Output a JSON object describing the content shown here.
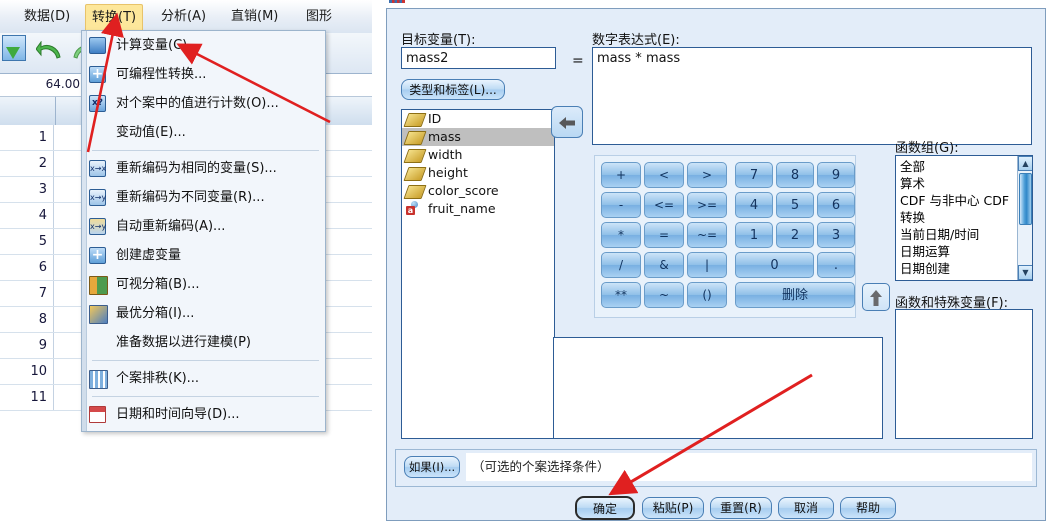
{
  "app": {
    "menubar": [
      {
        "label": "数据(D)",
        "accel": "D",
        "active": false
      },
      {
        "label": "转换(T)",
        "accel": "T",
        "active": true
      },
      {
        "label": "分析(A)",
        "accel": "A",
        "active": false
      },
      {
        "label": "直销(M)",
        "accel": "M",
        "active": false
      },
      {
        "label": "图形",
        "accel": "",
        "active": false
      }
    ],
    "cell_value": "64.00",
    "row_numbers": [
      "1",
      "2",
      "3",
      "4",
      "5",
      "6",
      "7",
      "8",
      "9",
      "10",
      "11"
    ]
  },
  "transform_menu": {
    "items": [
      {
        "label": "计算变量(C)...",
        "icon": "compute-variable-icon",
        "sep_after": false
      },
      {
        "label": "可编程性转换...",
        "icon": "programmability-transform-icon",
        "sep_after": false
      },
      {
        "label": "对个案中的值进行计数(O)...",
        "icon": "count-values-icon",
        "sep_after": false
      },
      {
        "label": "变动值(E)...",
        "icon": "none",
        "sep_after": true
      },
      {
        "label": "重新编码为相同的变量(S)...",
        "icon": "recode-same-icon",
        "sep_after": false
      },
      {
        "label": "重新编码为不同变量(R)...",
        "icon": "recode-different-icon",
        "sep_after": false
      },
      {
        "label": "自动重新编码(A)...",
        "icon": "auto-recode-icon",
        "sep_after": false
      },
      {
        "label": "创建虚变量",
        "icon": "create-dummy-icon",
        "sep_after": false
      },
      {
        "label": "可视分箱(B)...",
        "icon": "visual-binning-icon",
        "sep_after": false
      },
      {
        "label": "最优分箱(I)...",
        "icon": "optimal-binning-icon",
        "sep_after": false
      },
      {
        "label": "准备数据以进行建模(P)",
        "icon": "none",
        "sep_after": true
      },
      {
        "label": "个案排秩(K)...",
        "icon": "rank-cases-icon",
        "sep_after": true
      },
      {
        "label": "日期和时间向导(D)...",
        "icon": "date-time-wizard-icon",
        "sep_after": false
      }
    ]
  },
  "dialog": {
    "target_variable_label": "目标变量(T):",
    "target_variable_value": "mass2",
    "equals_sign": "=",
    "type_label_button": "类型和标签(L)...",
    "expression_label": "数字表达式(E):",
    "expression_value": "mass * mass",
    "move_button_icon": "arrow-left-icon",
    "up_button_icon": "arrow-up-icon",
    "variables": [
      {
        "name": "ID",
        "type": "scale",
        "selected": false
      },
      {
        "name": "mass",
        "type": "scale",
        "selected": true
      },
      {
        "name": "width",
        "type": "scale",
        "selected": false
      },
      {
        "name": "height",
        "type": "scale",
        "selected": false
      },
      {
        "name": "color_score",
        "type": "scale",
        "selected": false
      },
      {
        "name": "fruit_name",
        "type": "nominal-string",
        "selected": false
      }
    ],
    "keypad": [
      [
        "+",
        "<",
        ">",
        "7",
        "8",
        "9"
      ],
      [
        "-",
        "<=",
        ">=",
        "4",
        "5",
        "6"
      ],
      [
        "*",
        "=",
        "~=",
        "1",
        "2",
        "3"
      ],
      [
        "/",
        "&",
        "|",
        "0",
        "."
      ],
      [
        "**",
        "~",
        "()",
        "删除"
      ]
    ],
    "function_group_label": "函数组(G):",
    "function_groups": [
      "全部",
      "算术",
      "CDF 与非中心 CDF",
      "转换",
      "当前日期/时间",
      "日期运算",
      "日期创建"
    ],
    "functions_label": "函数和特殊变量(F):",
    "functions": [],
    "if_button": "如果(I)...",
    "if_text": "（可选的个案选择条件）",
    "footer_buttons": [
      {
        "label": "确定",
        "default": true
      },
      {
        "label": "粘贴(P)",
        "default": false
      },
      {
        "label": "重置(R)",
        "default": false
      },
      {
        "label": "取消",
        "default": false
      },
      {
        "label": "帮助",
        "default": false
      }
    ]
  },
  "annotations": {
    "arrow_color": "#e02020",
    "arrows": [
      {
        "name": "arrow-to-transform-menu"
      },
      {
        "name": "arrow-to-compute-variable"
      },
      {
        "name": "arrow-to-ok-button"
      }
    ]
  }
}
